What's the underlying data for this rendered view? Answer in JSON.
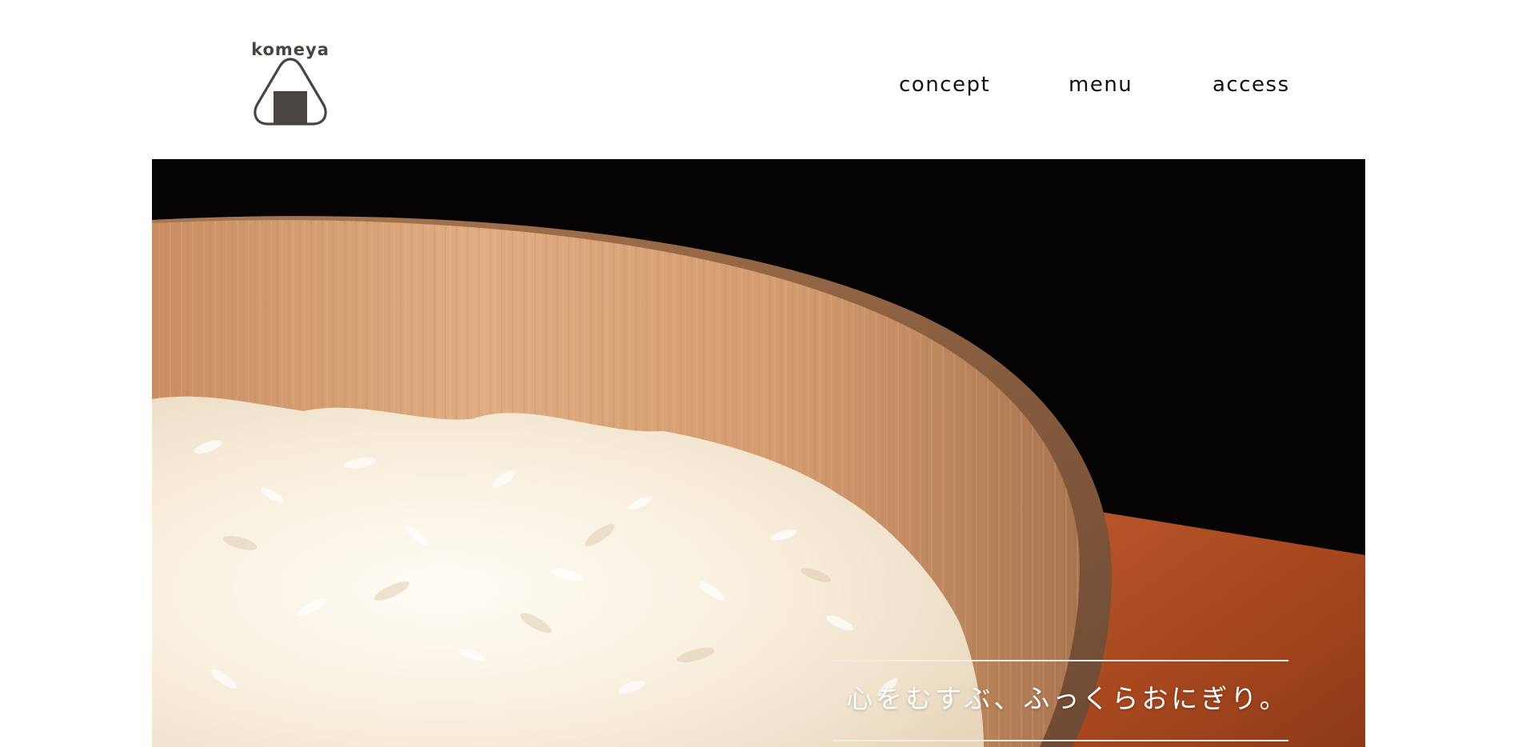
{
  "brand": {
    "logo_text": "komeya",
    "logo_icon": "onigiri-icon",
    "colors": {
      "logo": "#4a4440",
      "nav_text": "#111111",
      "hero_bg": "#050303",
      "tagline": "#ffffff"
    }
  },
  "nav": {
    "items": [
      {
        "label": "concept"
      },
      {
        "label": "menu"
      },
      {
        "label": "access"
      }
    ]
  },
  "hero": {
    "tagline": "心をむすぶ、ふっくらおにぎり。"
  }
}
